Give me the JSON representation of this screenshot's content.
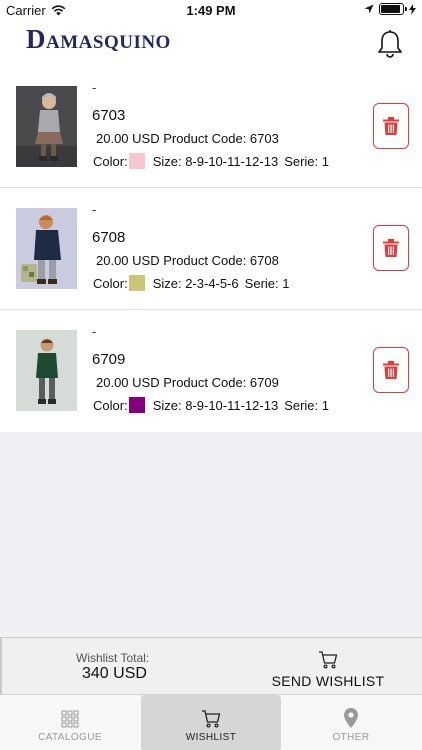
{
  "status_bar": {
    "carrier": "Carrier",
    "time": "1:49 PM",
    "battery_level": 0.9
  },
  "header": {
    "logo": "Damasquino",
    "bell_icon": "bell-icon"
  },
  "items": [
    {
      "dash": "-",
      "code": "6703",
      "price_line": "20.00 USD Product Code: 6703",
      "color_label": "Color:",
      "color": "#f7c4d2",
      "size": "Size: 8-9-10-11-12-13",
      "serie": "Serie: 1",
      "delete_icon": "trash-icon"
    },
    {
      "dash": "-",
      "code": "6708",
      "price_line": "20.00 USD Product Code: 6708",
      "color_label": "Color:",
      "color": "#cbc677",
      "size": "Size: 2-3-4-5-6",
      "serie": "Serie: 1",
      "delete_icon": "trash-icon"
    },
    {
      "dash": "-",
      "code": "6709",
      "price_line": "20.00 USD Product Code: 6709",
      "color_label": "Color:",
      "color": "#85007e",
      "size": "Size: 8-9-10-11-12-13",
      "serie": "Serie: 1",
      "delete_icon": "trash-icon"
    }
  ],
  "footer": {
    "total_label": "Wishlist Total:",
    "total_value": "340 USD",
    "send_label": "SEND WISHLIST"
  },
  "tabs": [
    {
      "label": "CATALOGUE",
      "icon": "grid-icon",
      "active": false
    },
    {
      "label": "WISHLIST",
      "icon": "cart-icon",
      "active": true
    },
    {
      "label": "OTHER",
      "icon": "location-pin-icon",
      "active": false
    }
  ]
}
